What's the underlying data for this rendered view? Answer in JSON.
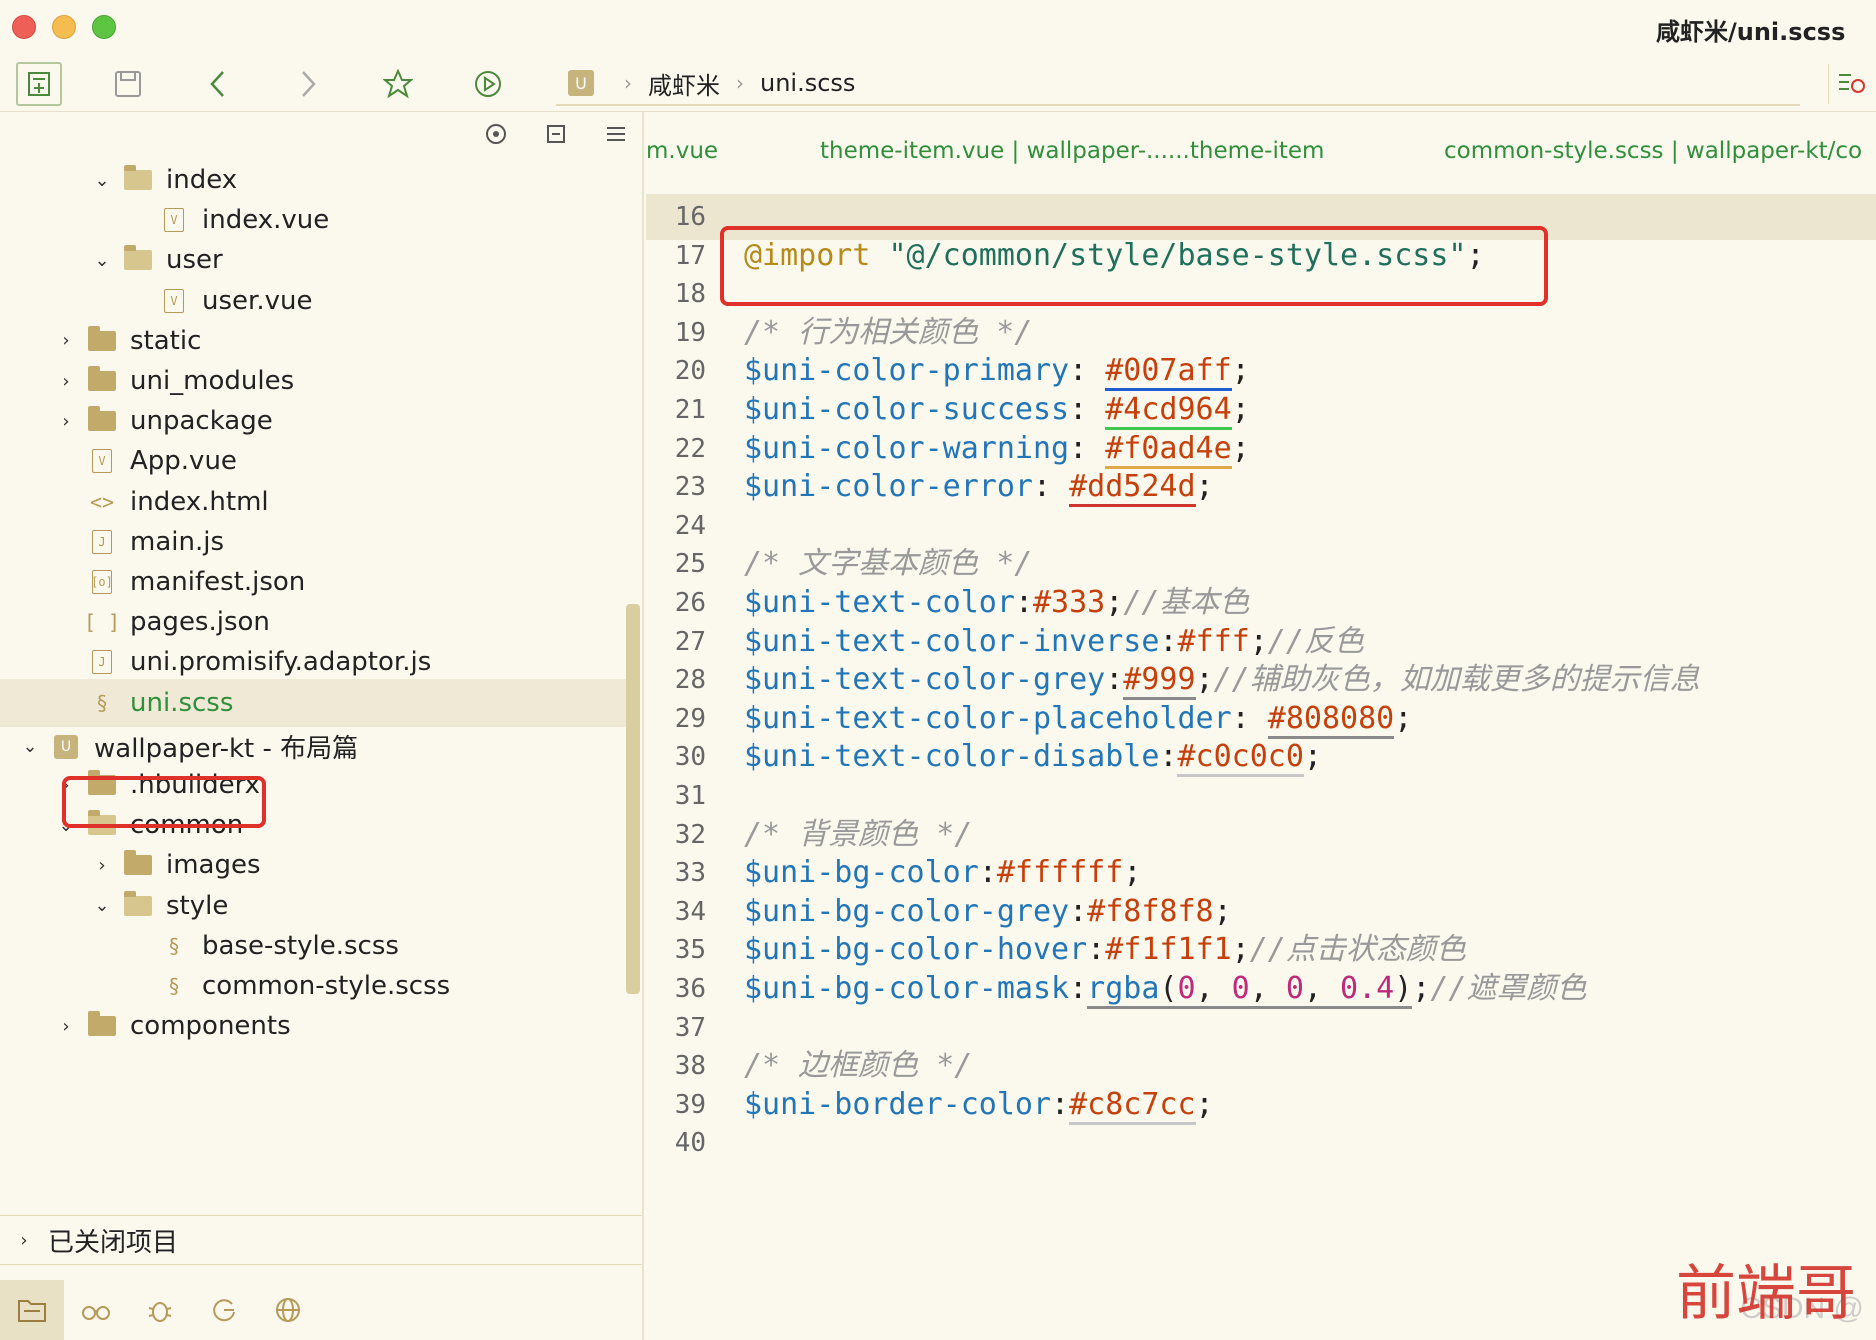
{
  "window": {
    "title": "咸虾米/uni.scss"
  },
  "toolbar": {
    "breadcrumb": {
      "project": "咸虾米",
      "file": "uni.scss"
    }
  },
  "sidebar": {
    "tree": [
      {
        "label": "index",
        "kind": "folder-open",
        "depth": 2,
        "expanded": true
      },
      {
        "label": "index.vue",
        "kind": "vue",
        "depth": 3
      },
      {
        "label": "user",
        "kind": "folder-open",
        "depth": 2,
        "expanded": true
      },
      {
        "label": "user.vue",
        "kind": "vue",
        "depth": 3
      },
      {
        "label": "static",
        "kind": "folder",
        "depth": 1,
        "expanded": false
      },
      {
        "label": "uni_modules",
        "kind": "folder",
        "depth": 1,
        "expanded": false
      },
      {
        "label": "unpackage",
        "kind": "folder",
        "depth": 1,
        "expanded": false
      },
      {
        "label": "App.vue",
        "kind": "vue",
        "depth": 1
      },
      {
        "label": "index.html",
        "kind": "html",
        "depth": 1
      },
      {
        "label": "main.js",
        "kind": "js",
        "depth": 1
      },
      {
        "label": "manifest.json",
        "kind": "manifest",
        "depth": 1
      },
      {
        "label": "pages.json",
        "kind": "json",
        "depth": 1
      },
      {
        "label": "uni.promisify.adaptor.js",
        "kind": "js",
        "depth": 1
      },
      {
        "label": "uni.scss",
        "kind": "scss",
        "depth": 1,
        "selected": true
      },
      {
        "label": "wallpaper-kt - 布局篇",
        "kind": "project",
        "depth": 0,
        "expanded": true
      },
      {
        "label": ".hbuilderx",
        "kind": "folder",
        "depth": 1,
        "expanded": false
      },
      {
        "label": "common",
        "kind": "folder-open",
        "depth": 1,
        "expanded": true
      },
      {
        "label": "images",
        "kind": "folder",
        "depth": 2,
        "expanded": false
      },
      {
        "label": "style",
        "kind": "folder-open",
        "depth": 2,
        "expanded": true
      },
      {
        "label": "base-style.scss",
        "kind": "scss",
        "depth": 3
      },
      {
        "label": "common-style.scss",
        "kind": "scss",
        "depth": 3
      },
      {
        "label": "components",
        "kind": "folder",
        "depth": 1,
        "expanded": false
      }
    ],
    "closed_projects_label": "已关闭项目"
  },
  "editor": {
    "tabs": [
      {
        "label": "m.vue"
      },
      {
        "label": "theme-item.vue | wallpaper-......theme-item"
      },
      {
        "label": "common-style.scss | wallpaper-kt/co"
      }
    ],
    "lines": [
      {
        "n": "16",
        "tokens": []
      },
      {
        "n": "17",
        "tokens": [
          {
            "t": "@import",
            "c": "kw"
          },
          {
            "t": " "
          },
          {
            "t": "\"@/common/style/base-style.scss\"",
            "c": "str"
          },
          {
            "t": ";"
          }
        ]
      },
      {
        "n": "18",
        "tokens": []
      },
      {
        "n": "19",
        "tokens": [
          {
            "t": "/* 行为相关颜色 */",
            "c": "cm"
          }
        ]
      },
      {
        "n": "20",
        "tokens": [
          {
            "t": "$uni-color-primary",
            "c": "var"
          },
          {
            "t": ": "
          },
          {
            "t": "#007aff",
            "c": "hex",
            "u": "u-blue"
          },
          {
            "t": ";"
          }
        ]
      },
      {
        "n": "21",
        "tokens": [
          {
            "t": "$uni-color-success",
            "c": "var"
          },
          {
            "t": ": "
          },
          {
            "t": "#4cd964",
            "c": "hex",
            "u": "u-green"
          },
          {
            "t": ";"
          }
        ]
      },
      {
        "n": "22",
        "tokens": [
          {
            "t": "$uni-color-warning",
            "c": "var"
          },
          {
            "t": ": "
          },
          {
            "t": "#f0ad4e",
            "c": "hex",
            "u": "u-orange"
          },
          {
            "t": ";"
          }
        ]
      },
      {
        "n": "23",
        "tokens": [
          {
            "t": "$uni-color-error",
            "c": "var"
          },
          {
            "t": ": "
          },
          {
            "t": "#dd524d",
            "c": "hex",
            "u": "u-red"
          },
          {
            "t": ";"
          }
        ]
      },
      {
        "n": "24",
        "tokens": []
      },
      {
        "n": "25",
        "tokens": [
          {
            "t": "/* 文字基本颜色 */",
            "c": "cm"
          }
        ]
      },
      {
        "n": "26",
        "tokens": [
          {
            "t": "$uni-text-color",
            "c": "var"
          },
          {
            "t": ":"
          },
          {
            "t": "#333",
            "c": "hex"
          },
          {
            "t": ";"
          },
          {
            "t": "//基本色",
            "c": "cm"
          }
        ]
      },
      {
        "n": "27",
        "tokens": [
          {
            "t": "$uni-text-color-inverse",
            "c": "var"
          },
          {
            "t": ":"
          },
          {
            "t": "#fff",
            "c": "hex"
          },
          {
            "t": ";"
          },
          {
            "t": "//反色",
            "c": "cm"
          }
        ]
      },
      {
        "n": "28",
        "tokens": [
          {
            "t": "$uni-text-color-grey",
            "c": "var"
          },
          {
            "t": ":"
          },
          {
            "t": "#999",
            "c": "hex",
            "u": "u-gray"
          },
          {
            "t": ";"
          },
          {
            "t": "//辅助灰色，如加载更多的提示信息",
            "c": "cm"
          }
        ]
      },
      {
        "n": "29",
        "tokens": [
          {
            "t": "$uni-text-color-placeholder",
            "c": "var"
          },
          {
            "t": ": "
          },
          {
            "t": "#808080",
            "c": "hex",
            "u": "u-gray"
          },
          {
            "t": ";"
          }
        ]
      },
      {
        "n": "30",
        "tokens": [
          {
            "t": "$uni-text-color-disable",
            "c": "var"
          },
          {
            "t": ":"
          },
          {
            "t": "#c0c0c0",
            "c": "hex",
            "u": "u-lgray"
          },
          {
            "t": ";"
          }
        ]
      },
      {
        "n": "31",
        "tokens": []
      },
      {
        "n": "32",
        "tokens": [
          {
            "t": "/* 背景颜色 */",
            "c": "cm"
          }
        ]
      },
      {
        "n": "33",
        "tokens": [
          {
            "t": "$uni-bg-color",
            "c": "var"
          },
          {
            "t": ":"
          },
          {
            "t": "#ffffff",
            "c": "hex"
          },
          {
            "t": ";"
          }
        ]
      },
      {
        "n": "34",
        "tokens": [
          {
            "t": "$uni-bg-color-grey",
            "c": "var"
          },
          {
            "t": ":"
          },
          {
            "t": "#f8f8f8",
            "c": "hex"
          },
          {
            "t": ";"
          }
        ]
      },
      {
        "n": "35",
        "tokens": [
          {
            "t": "$uni-bg-color-hover",
            "c": "var"
          },
          {
            "t": ":"
          },
          {
            "t": "#f1f1f1",
            "c": "hex"
          },
          {
            "t": ";"
          },
          {
            "t": "//点击状态颜色",
            "c": "cm"
          }
        ]
      },
      {
        "n": "36",
        "tokens": [
          {
            "t": "$uni-bg-color-mask",
            "c": "var"
          },
          {
            "t": ":"
          },
          {
            "t": "rgba",
            "c": "var",
            "u": "u-gray"
          },
          {
            "t": "(",
            "u": "u-gray"
          },
          {
            "t": "0",
            "c": "num",
            "u": "u-gray"
          },
          {
            "t": ", ",
            "u": "u-gray"
          },
          {
            "t": "0",
            "c": "num",
            "u": "u-gray"
          },
          {
            "t": ", ",
            "u": "u-gray"
          },
          {
            "t": "0",
            "c": "num",
            "u": "u-gray"
          },
          {
            "t": ", ",
            "u": "u-gray"
          },
          {
            "t": "0.4",
            "c": "num",
            "u": "u-gray"
          },
          {
            "t": ")",
            "u": "u-gray"
          },
          {
            "t": ";"
          },
          {
            "t": "//遮罩颜色",
            "c": "cm"
          }
        ]
      },
      {
        "n": "37",
        "tokens": []
      },
      {
        "n": "38",
        "tokens": [
          {
            "t": "/* 边框颜色 */",
            "c": "cm"
          }
        ]
      },
      {
        "n": "39",
        "tokens": [
          {
            "t": "$uni-border-color",
            "c": "var"
          },
          {
            "t": ":"
          },
          {
            "t": "#c8c7cc",
            "c": "hex",
            "u": "u-lgray"
          },
          {
            "t": ";"
          }
        ]
      },
      {
        "n": "40",
        "tokens": []
      }
    ],
    "current_line": "16"
  },
  "watermark": {
    "text": "前端哥",
    "csdn": "CSDN @"
  },
  "colors": {
    "background": "#fbf8ee",
    "accent_green": "#2f8f3a",
    "highlight_red": "#e0302a"
  }
}
